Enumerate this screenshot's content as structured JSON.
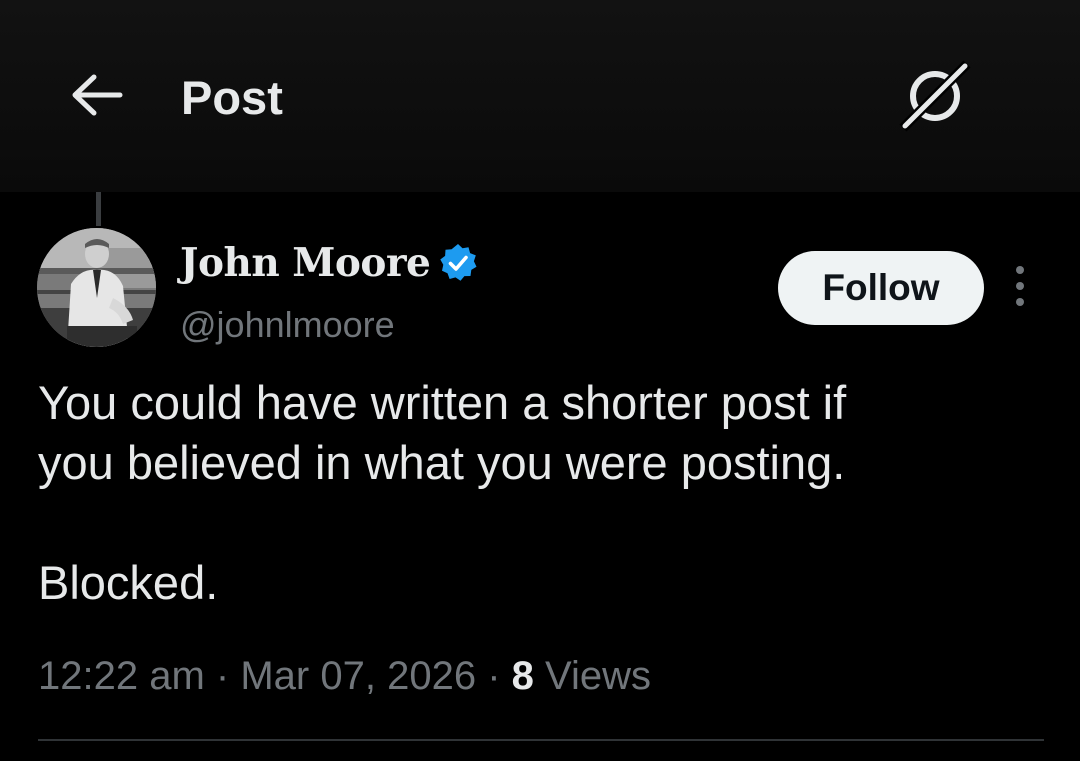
{
  "header": {
    "title": "Post",
    "back_icon": "arrow-left-icon",
    "grok_icon": "grok-icon"
  },
  "author": {
    "name": "John Moore",
    "handle": "@johnlmoore",
    "verified": true,
    "verified_color": "#1d9bf0"
  },
  "follow_label": "Follow",
  "more_icon": "more-vertical-icon",
  "post": {
    "line_1": "You could have written a shorter post if",
    "line_2": "you believed in what you were posting.",
    "line_3": "Blocked."
  },
  "meta": {
    "time": "12:22 am",
    "separator": "·",
    "date": "Mar 07, 2026",
    "views_count": "8",
    "views_label": "Views"
  },
  "colors": {
    "background": "#000000",
    "text": "#e7e9ea",
    "secondary_text": "#71767b",
    "follow_bg": "#eff3f4",
    "divider": "#2f3336"
  }
}
